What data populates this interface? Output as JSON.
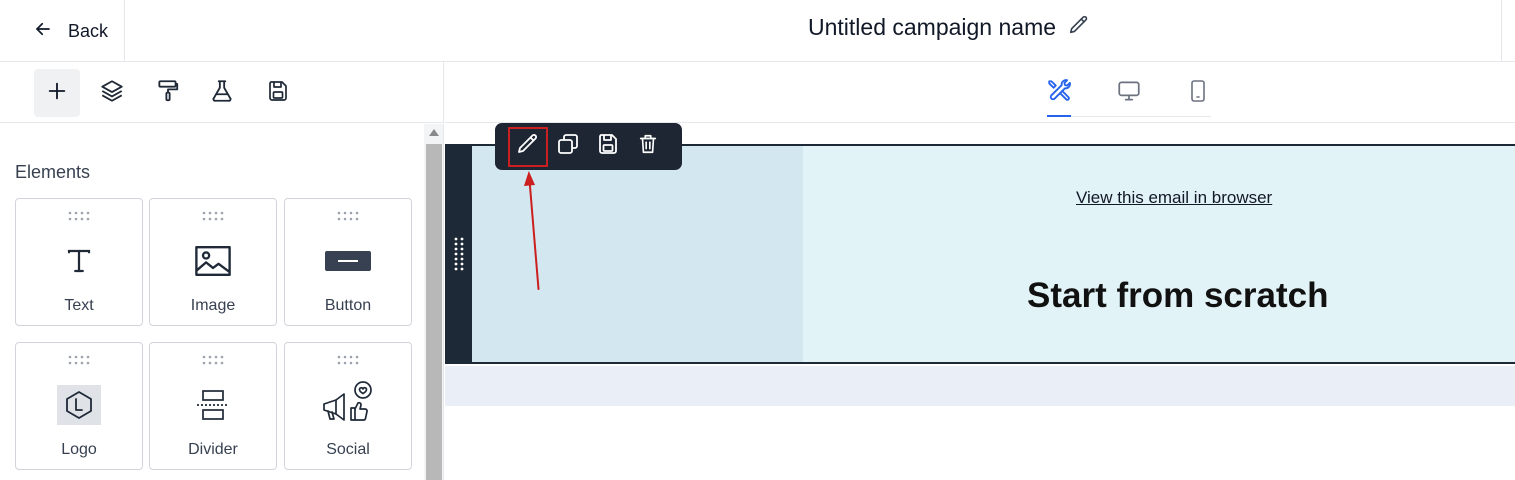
{
  "header": {
    "back_label": "Back",
    "campaign_title": "Untitled campaign name"
  },
  "left_toolbar": {
    "tools": [
      "plus-icon",
      "layers-icon",
      "paint-roller-icon",
      "flask-icon",
      "save-icon"
    ],
    "active_tool": "plus-icon"
  },
  "view_modes": {
    "items": [
      "tools-icon",
      "desktop-icon",
      "mobile-icon"
    ],
    "active": "tools-icon"
  },
  "sidebar": {
    "section_title": "Elements",
    "elements": [
      {
        "label": "Text",
        "icon": "text-icon"
      },
      {
        "label": "Image",
        "icon": "image-icon"
      },
      {
        "label": "Button",
        "icon": "button-icon"
      },
      {
        "label": "Logo",
        "icon": "logo-icon"
      },
      {
        "label": "Divider",
        "icon": "divider-icon"
      },
      {
        "label": "Social",
        "icon": "social-icon"
      }
    ]
  },
  "floating_toolbar": {
    "buttons": [
      "edit-icon",
      "duplicate-icon",
      "save-icon",
      "delete-icon"
    ],
    "highlighted": "edit-icon"
  },
  "canvas": {
    "view_in_browser_link": "View this email in browser",
    "headline": "Start from scratch"
  },
  "colors": {
    "accent": "#2563eb",
    "dark": "#1e2533",
    "annotation": "#cc1f1f",
    "email_bg": "#e2f3f8",
    "column_bg": "#d2e7ef"
  }
}
